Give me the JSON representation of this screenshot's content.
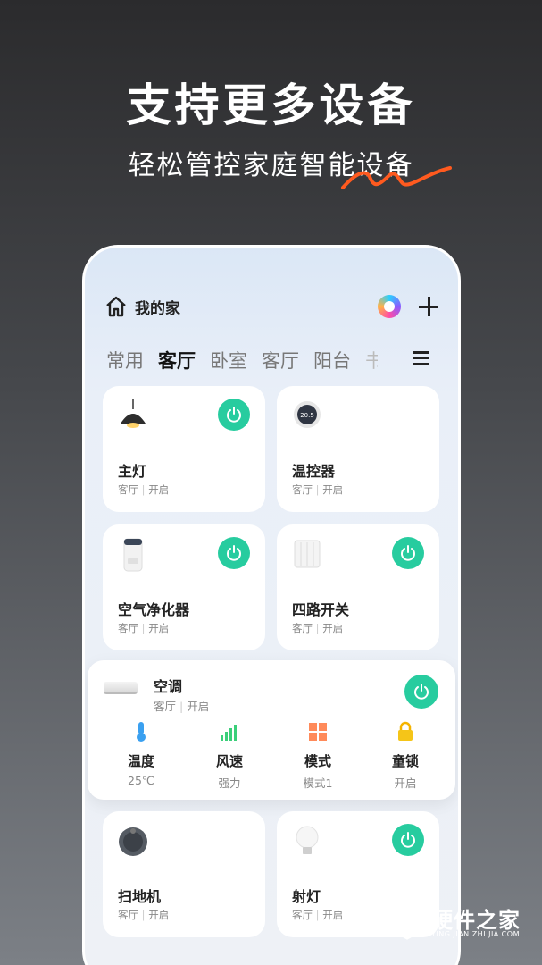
{
  "hero": {
    "title": "支持更多设备",
    "subtitle": "轻松管控家庭智能设备"
  },
  "header": {
    "home_label": "我的家"
  },
  "tabs": [
    "常用",
    "客厅",
    "卧室",
    "客厅",
    "阳台",
    "书"
  ],
  "active_tab": 1,
  "devices": [
    {
      "name": "主灯",
      "room": "客厅",
      "status": "开启",
      "icon": "pendant-lamp-icon",
      "power_on": true
    },
    {
      "name": "温控器",
      "room": "客厅",
      "status": "开启",
      "icon": "thermostat-icon",
      "display": "20.5",
      "power_on": false
    },
    {
      "name": "空气净化器",
      "room": "客厅",
      "status": "开启",
      "icon": "air-purifier-icon",
      "power_on": true
    },
    {
      "name": "四路开关",
      "room": "客厅",
      "status": "开启",
      "icon": "switch-panel-icon",
      "power_on": true
    },
    {
      "name": "扫地机",
      "room": "客厅",
      "status": "开启",
      "icon": "robot-vacuum-icon",
      "power_on": false
    },
    {
      "name": "射灯",
      "room": "客厅",
      "status": "开启",
      "icon": "bulb-icon",
      "power_on": true
    }
  ],
  "ac": {
    "name": "空调",
    "room": "客厅",
    "status": "开启",
    "controls": [
      {
        "label": "温度",
        "value": "25℃",
        "icon": "thermometer-icon"
      },
      {
        "label": "风速",
        "value": "强力",
        "icon": "signal-bars-icon"
      },
      {
        "label": "模式",
        "value": "模式1",
        "icon": "grid-icon"
      },
      {
        "label": "童锁",
        "value": "开启",
        "icon": "lock-icon"
      }
    ]
  },
  "watermark": {
    "title": "硬件之家",
    "subtitle": "YING JIAN ZHI JIA.COM"
  },
  "colors": {
    "power_green": "#27cc9f",
    "accent_orange": "#ff5a1f"
  }
}
